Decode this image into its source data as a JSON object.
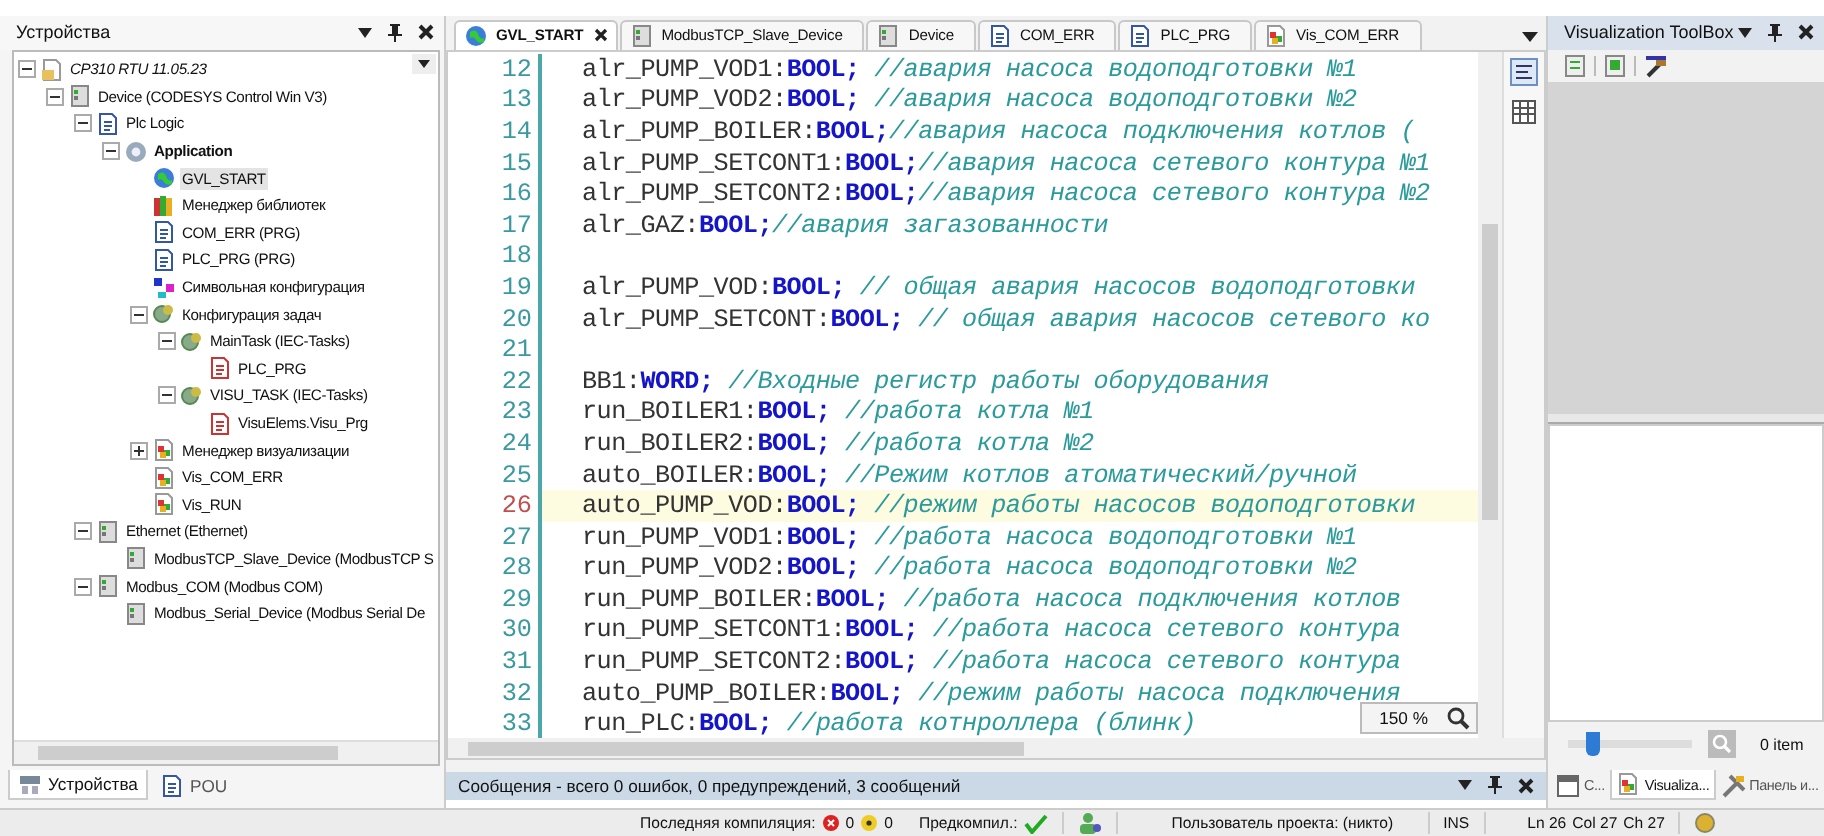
{
  "left_panel": {
    "title": "Устройства",
    "tree": [
      {
        "label": "CP310 RTU 11.05.23",
        "kind": "project",
        "selected": false,
        "expanded": true,
        "children": [
          {
            "label": "Device (CODESYS Control Win V3)",
            "kind": "device",
            "selected": false,
            "expanded": true,
            "children": [
              {
                "label": "Plc Logic",
                "kind": "plc",
                "selected": false,
                "expanded": true,
                "children": [
                  {
                    "label": "Application",
                    "kind": "app",
                    "selected": false,
                    "expanded": true,
                    "children": [
                      {
                        "label": "GVL_START",
                        "kind": "gvl",
                        "selected": true
                      },
                      {
                        "label": "Менеджер библиотек",
                        "kind": "library",
                        "selected": false
                      },
                      {
                        "label": "COM_ERR (PRG)",
                        "kind": "pou",
                        "selected": false
                      },
                      {
                        "label": "PLC_PRG (PRG)",
                        "kind": "prg",
                        "selected": false
                      },
                      {
                        "label": "Символьная конфигурация",
                        "kind": "symbol",
                        "selected": false
                      },
                      {
                        "label": "Конфигурация задач",
                        "kind": "tasks",
                        "selected": false,
                        "expanded": true,
                        "children": [
                          {
                            "label": "MainTask (IEC-Tasks)",
                            "kind": "task",
                            "selected": false,
                            "expanded": true,
                            "children": [
                              {
                                "label": "PLC_PRG",
                                "kind": "call",
                                "selected": false
                              }
                            ]
                          },
                          {
                            "label": "VISU_TASK (IEC-Tasks)",
                            "kind": "task",
                            "selected": false,
                            "expanded": true,
                            "children": [
                              {
                                "label": "VisuElems.Visu_Prg",
                                "kind": "call",
                                "selected": false
                              }
                            ]
                          }
                        ]
                      },
                      {
                        "label": "Менеджер визуализации",
                        "kind": "visman",
                        "selected": false,
                        "expanded": false
                      },
                      {
                        "label": "Vis_COM_ERR",
                        "kind": "visu",
                        "selected": false
                      },
                      {
                        "label": "Vis_RUN",
                        "kind": "visu",
                        "selected": false
                      }
                    ]
                  }
                ]
              },
              {
                "label": "Ethernet (Ethernet)",
                "kind": "device",
                "selected": false,
                "expanded": true,
                "children": [
                  {
                    "label": "ModbusTCP_Slave_Device (ModbusTCP S",
                    "kind": "device",
                    "selected": false
                  }
                ]
              },
              {
                "label": "Modbus_COM (Modbus COM)",
                "kind": "device",
                "selected": false,
                "expanded": true,
                "children": [
                  {
                    "label": "Modbus_Serial_Device (Modbus Serial De",
                    "kind": "device",
                    "selected": false
                  }
                ]
              }
            ]
          }
        ]
      }
    ],
    "tabs": [
      {
        "label": "Устройства",
        "kind": "devices",
        "selected": true
      },
      {
        "label": "POU",
        "kind": "pou",
        "selected": false
      }
    ]
  },
  "editor": {
    "tabs": [
      {
        "label": "GVL_START",
        "kind": "gvl",
        "selected": true
      },
      {
        "label": "ModbusTCP_Slave_Device",
        "kind": "device",
        "selected": false
      },
      {
        "label": "Device",
        "kind": "device",
        "selected": false
      },
      {
        "label": "COM_ERR",
        "kind": "pou",
        "selected": false
      },
      {
        "label": "PLC_PRG",
        "kind": "prg",
        "selected": false
      },
      {
        "label": "Vis_COM_ERR",
        "kind": "visu",
        "selected": false
      }
    ],
    "lines": [
      {
        "number": "12",
        "name": "alr_PUMP_VOD1:",
        "type": "BOOL;",
        "comment": " //авария насоса водоподготовки №1",
        "current": false
      },
      {
        "number": "13",
        "name": "alr_PUMP_VOD2:",
        "type": "BOOL;",
        "comment": " //авария насоса водоподготовки №2",
        "current": false
      },
      {
        "number": "14",
        "name": "alr_PUMP_BOILER:",
        "type": "BOOL;",
        "comment": "//авария насоса подключения котлов (",
        "current": false
      },
      {
        "number": "15",
        "name": "alr_PUMP_SETCONT1:",
        "type": "BOOL;",
        "comment": "//авария насоса сетевого контура №1",
        "current": false
      },
      {
        "number": "16",
        "name": "alr_PUMP_SETCONT2:",
        "type": "BOOL;",
        "comment": "//авария насоса сетевого контура №2",
        "current": false
      },
      {
        "number": "17",
        "name": "alr_GAZ:",
        "type": "BOOL;",
        "comment": "//авария загазованности",
        "current": false
      },
      {
        "number": "18",
        "current": false
      },
      {
        "number": "19",
        "name": "alr_PUMP_VOD:",
        "type": "BOOL;",
        "comment": " // общая авария насосов водоподготовки",
        "current": false
      },
      {
        "number": "20",
        "name": "alr_PUMP_SETCONT:",
        "type": "BOOL;",
        "comment": " // общая авария насосов сетевого ко",
        "current": false
      },
      {
        "number": "21",
        "current": false
      },
      {
        "number": "22",
        "name": "BB1:",
        "type": "WORD;",
        "comment": " //Входные регистр работы оборудования",
        "current": false
      },
      {
        "number": "23",
        "name": "run_BOILER1:",
        "type": "BOOL;",
        "comment": " //работа котла №1",
        "current": false
      },
      {
        "number": "24",
        "name": "run_BOILER2:",
        "type": "BOOL;",
        "comment": " //работа котла №2",
        "current": false
      },
      {
        "number": "25",
        "name": "auto_BOILER:",
        "type": "BOOL;",
        "comment": " //Режим котлов атоматический/ручной",
        "current": false
      },
      {
        "number": "26",
        "name": "auto_PUMP_VOD:",
        "type": "BOOL;",
        "comment": " //режим работы насосов водоподготовки",
        "current": true
      },
      {
        "number": "27",
        "name": "run_PUMP_VOD1:",
        "type": "BOOL;",
        "comment": " //работа насоса водоподготовки №1",
        "current": false
      },
      {
        "number": "28",
        "name": "run_PUMP_VOD2:",
        "type": "BOOL;",
        "comment": " //работа насоса водоподготовки №2",
        "current": false
      },
      {
        "number": "29",
        "name": "run_PUMP_BOILER:",
        "type": "BOOL;",
        "comment": " //работа насоса подключения котлов",
        "current": false
      },
      {
        "number": "30",
        "name": "run_PUMP_SETCONT1:",
        "type": "BOOL;",
        "comment": " //работа насоса сетевого контура",
        "current": false
      },
      {
        "number": "31",
        "name": "run_PUMP_SETCONT2:",
        "type": "BOOL;",
        "comment": " //работа насоса сетевого контура",
        "current": false
      },
      {
        "number": "32",
        "name": "auto_PUMP_BOILER:",
        "type": "BOOL;",
        "comment": " //режим работы насоса подключения",
        "current": false
      },
      {
        "number": "33",
        "name": "run_PLC:",
        "type": "BOOL;",
        "comment": " //работа котнроллера (блинк)",
        "current": false
      }
    ],
    "zoom": "150 %"
  },
  "messages": {
    "title": "Сообщения - всего 0 ошибок, 0 предупреждений, 3 сообщений"
  },
  "right_panel": {
    "title": "Visualization ToolBox",
    "slider": {
      "level": 0.2
    },
    "items_label": "0 item",
    "tabs": [
      {
        "label": "С...",
        "kind": "properties",
        "selected": false
      },
      {
        "label": "Visualiza...",
        "kind": "visu",
        "selected": true
      },
      {
        "label": "Панель и...",
        "kind": "tools",
        "selected": false
      }
    ]
  },
  "status_bar": {
    "last_compile_label": "Последняя компиляция:",
    "errors": "0",
    "warnings": "0",
    "precompile_label": "Предкомпил.:",
    "user": "Пользователь проекта: (никто)",
    "mode": "INS",
    "ln": "Ln 26",
    "col": "Col 27",
    "ch": "Ch 27"
  }
}
